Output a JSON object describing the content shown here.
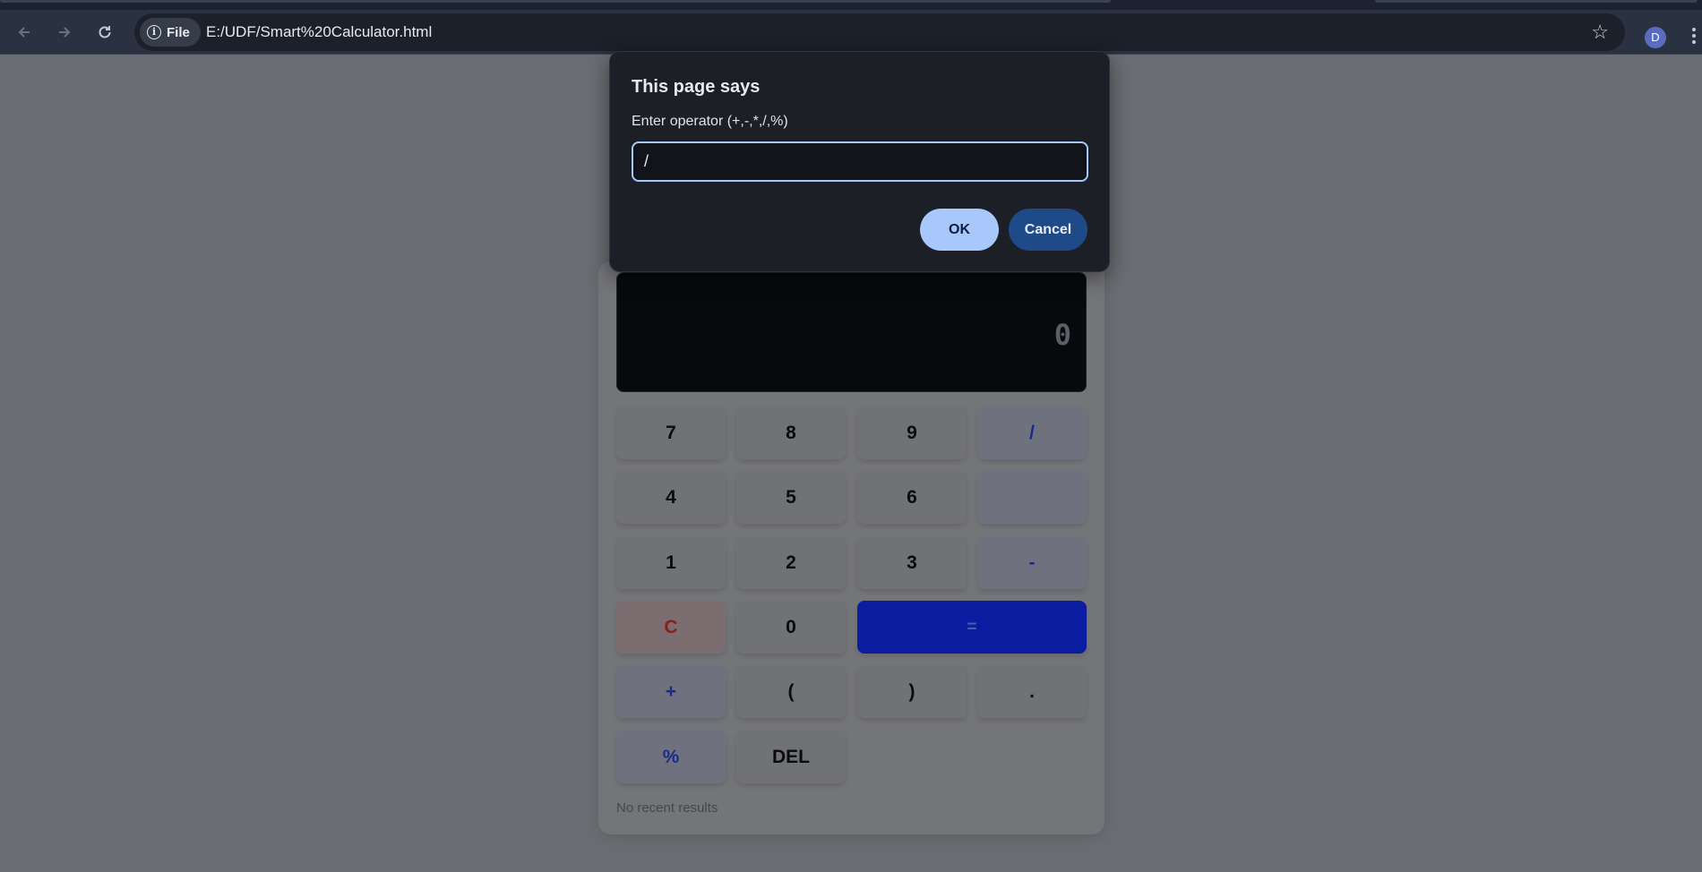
{
  "browser": {
    "site_chip_label": "File",
    "url": "E:/UDF/Smart%20Calculator.html",
    "profile_initial": "D",
    "icons": {
      "back": "arrow-left-icon",
      "forward": "arrow-right-icon",
      "reload": "reload-icon",
      "info": "info-icon",
      "bookmark": "star-icon",
      "menu": "kebab-icon"
    }
  },
  "dialog": {
    "title": "This page says",
    "message": "Enter operator (+,-,*,/,%)",
    "input_value": "/",
    "ok_label": "OK",
    "cancel_label": "Cancel"
  },
  "calculator": {
    "display_value": "0",
    "keys": {
      "k7": "7",
      "k8": "8",
      "k9": "9",
      "divide": "/",
      "k4": "4",
      "k5": "5",
      "k6": "6",
      "multiply": "",
      "k1": "1",
      "k2": "2",
      "k3": "3",
      "minus": "-",
      "clear": "C",
      "k0": "0",
      "equals": "=",
      "plus": "+",
      "open_paren": "(",
      "close_paren": ")",
      "decimal": ".",
      "percent": "%",
      "delete": "DEL"
    },
    "history_text": "No recent results"
  },
  "colors": {
    "accent": "#a8c7fa",
    "equals_key": "#0a1da1",
    "clear_text": "#8b1d1d",
    "operator_text": "#1a2a8a"
  }
}
